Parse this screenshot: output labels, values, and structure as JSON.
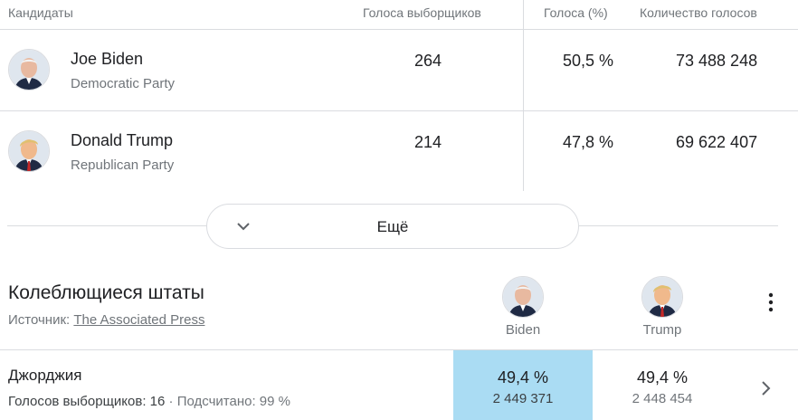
{
  "results_table": {
    "headers": {
      "candidates": "Кандидаты",
      "electoral_votes": "Голоса выборщиков",
      "vote_percent": "Голоса (%)",
      "vote_count": "Количество голосов"
    },
    "rows": [
      {
        "name": "Joe Biden",
        "party": "Democratic Party",
        "electoral_votes": "264",
        "vote_percent": "50,5 %",
        "vote_count": "73 488 248"
      },
      {
        "name": "Donald Trump",
        "party": "Republican Party",
        "electoral_votes": "214",
        "vote_percent": "47,8 %",
        "vote_count": "69 622 407"
      }
    ]
  },
  "more_button": {
    "label": "Ещё",
    "icon": "chevron-down-icon"
  },
  "swing_states": {
    "title": "Колеблющиеся штаты",
    "source_prefix": "Источник:",
    "source_link": "The Associated Press",
    "candidates": [
      {
        "label": "Biden"
      },
      {
        "label": "Trump"
      }
    ],
    "menu_icon": "more-vert-icon",
    "rows": [
      {
        "state": "Джорджия",
        "electoral_label": "Голосов выборщиков: 16",
        "separator": "·",
        "counted_label": "Подсчитано: 99 %",
        "biden_pct": "49,4 %",
        "biden_votes": "2 449 371",
        "trump_pct": "49,4 %",
        "trump_votes": "2 448 454",
        "leader_color": "#aadcf3"
      }
    ]
  }
}
